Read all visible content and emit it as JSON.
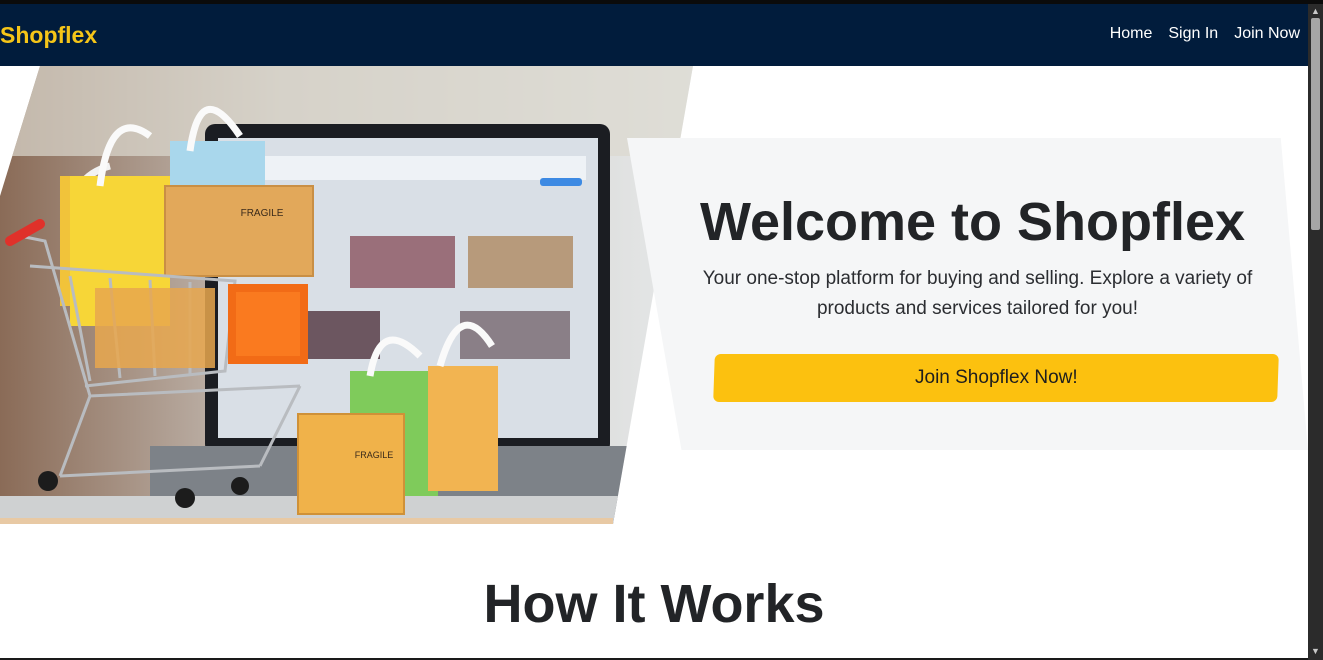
{
  "navbar": {
    "brand": "Shopflex",
    "links": [
      "Home",
      "Sign In",
      "Join Now"
    ]
  },
  "hero": {
    "title": "Welcome to Shopflex",
    "subtitle": "Your one-stop platform for buying and selling. Explore a variety of products and services tailored for you!",
    "cta_label": "Join Shopflex Now!",
    "image_box_labels": [
      "FRAGILE",
      "FRAGILE"
    ]
  },
  "how": {
    "title": "How It Works"
  },
  "colors": {
    "navbar_bg": "#011c3c",
    "brand": "#f5c518",
    "cta_bg": "#fcc10f",
    "panel_bg": "#f5f6f7"
  },
  "scrollbar": {
    "up_icon": "chevron-up-icon",
    "down_icon": "chevron-down-icon"
  }
}
